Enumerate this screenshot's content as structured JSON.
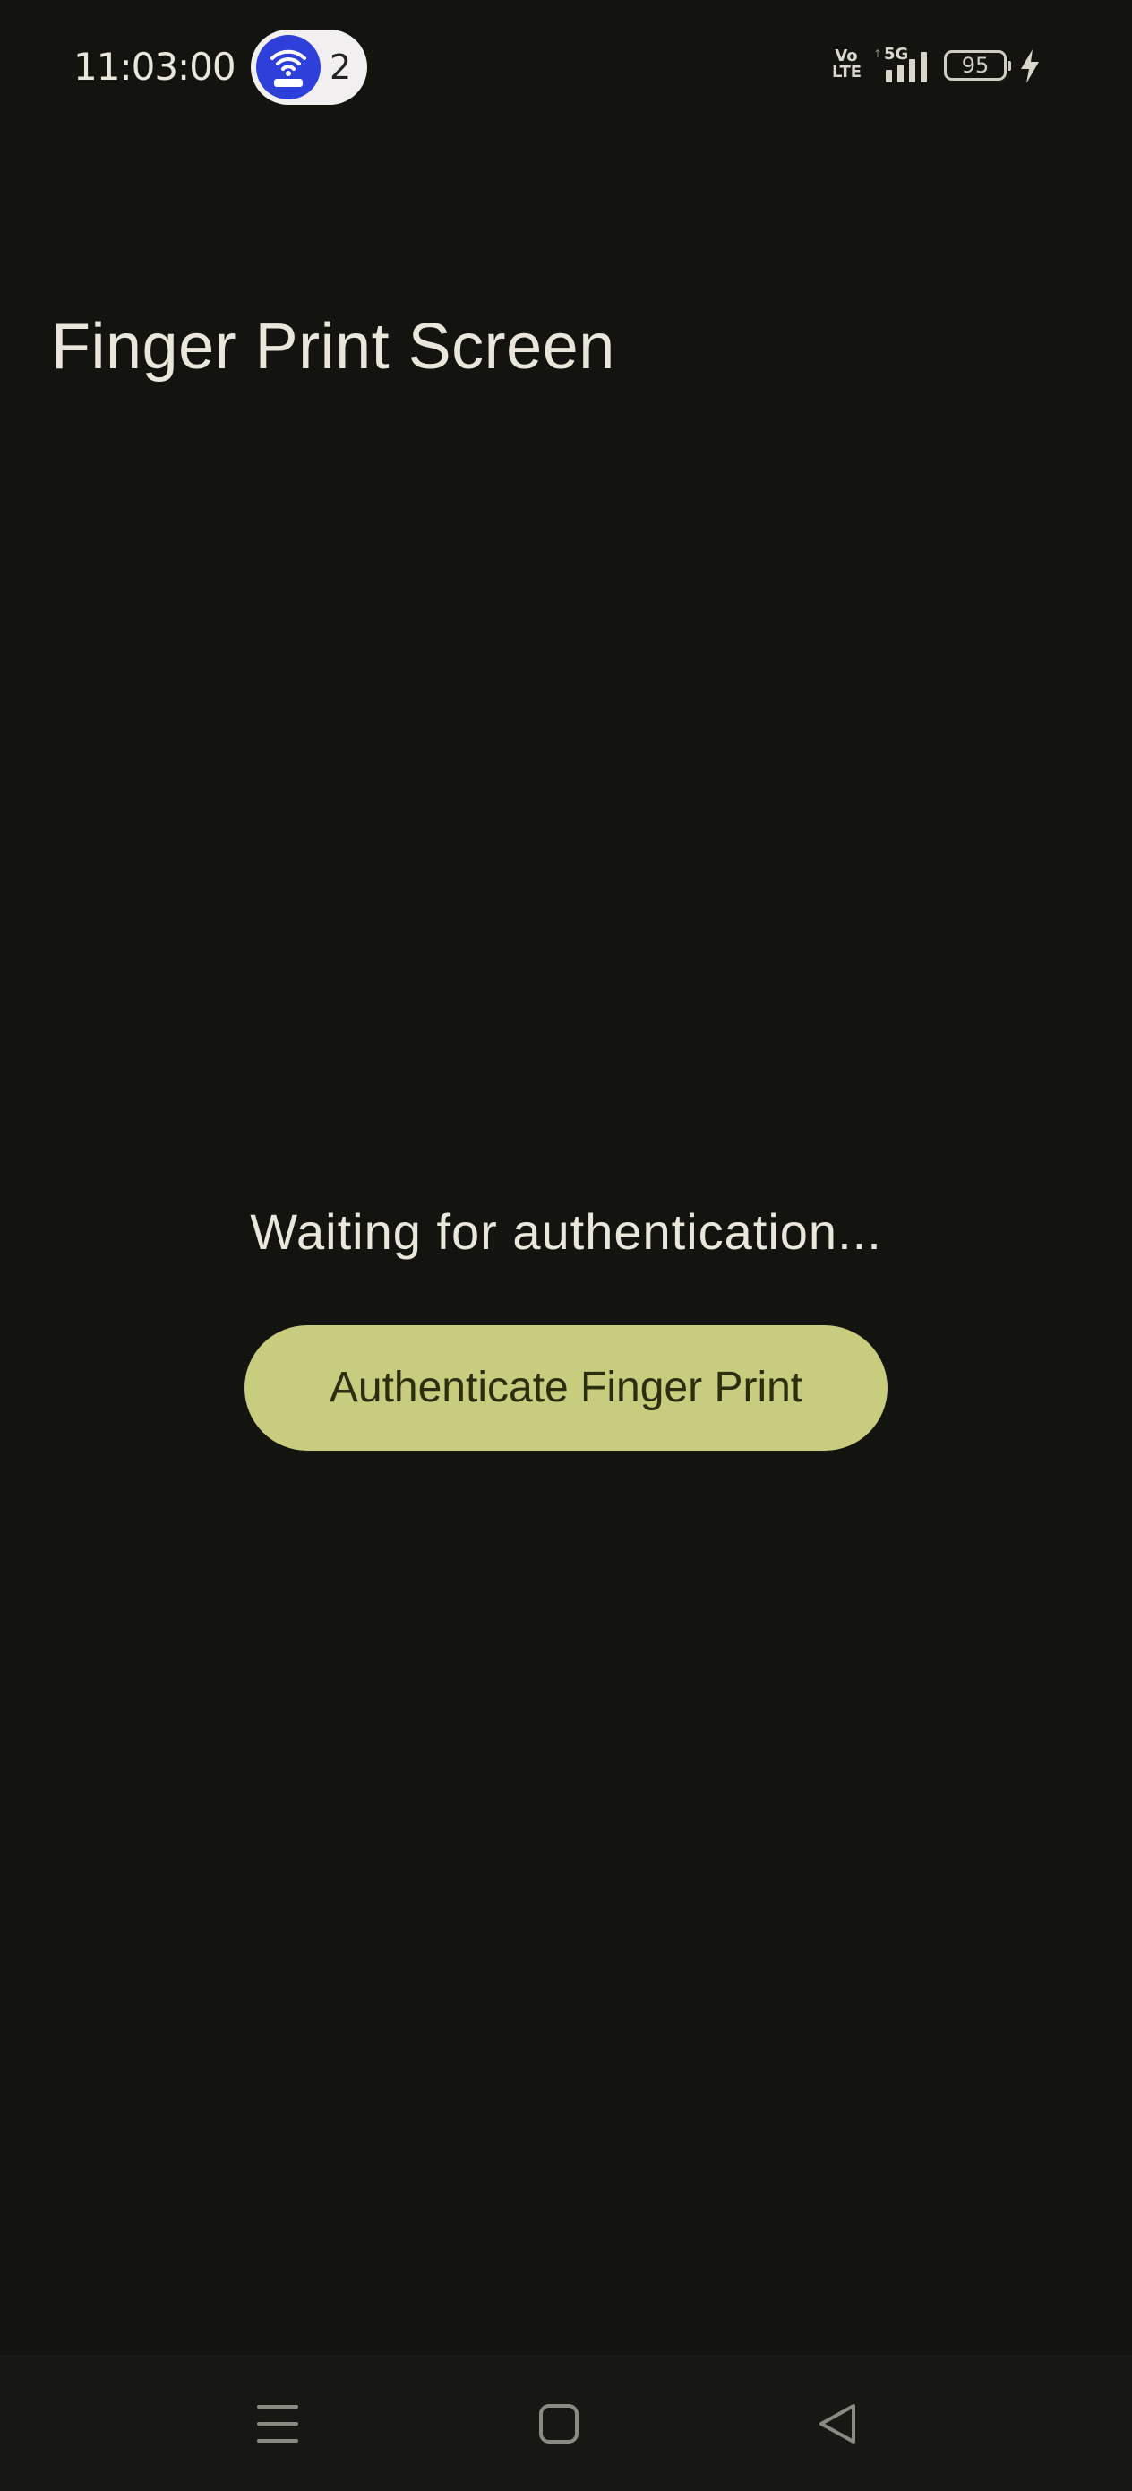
{
  "status_bar": {
    "time": "11:03:00",
    "hotspot_count": "2",
    "volte_label_top": "Vo",
    "volte_label_bottom": "LTE",
    "network_label": "5G",
    "battery_level": "95",
    "icons": [
      "hotspot-icon",
      "volte-icon",
      "signal-icon",
      "battery-icon",
      "charging-icon"
    ]
  },
  "app": {
    "title": "Finger Print Screen"
  },
  "main": {
    "status_message": "Waiting for authentication...",
    "auth_button_label": "Authenticate Finger Print"
  },
  "nav_bar": {
    "icons": [
      "menu-icon",
      "home-icon",
      "back-icon"
    ]
  },
  "colors": {
    "background": "#13140f",
    "button": "#c7cc7e",
    "button_text": "#2b2f10",
    "text": "#e9e6dc",
    "hotspot_accent": "#2f3fd9"
  }
}
